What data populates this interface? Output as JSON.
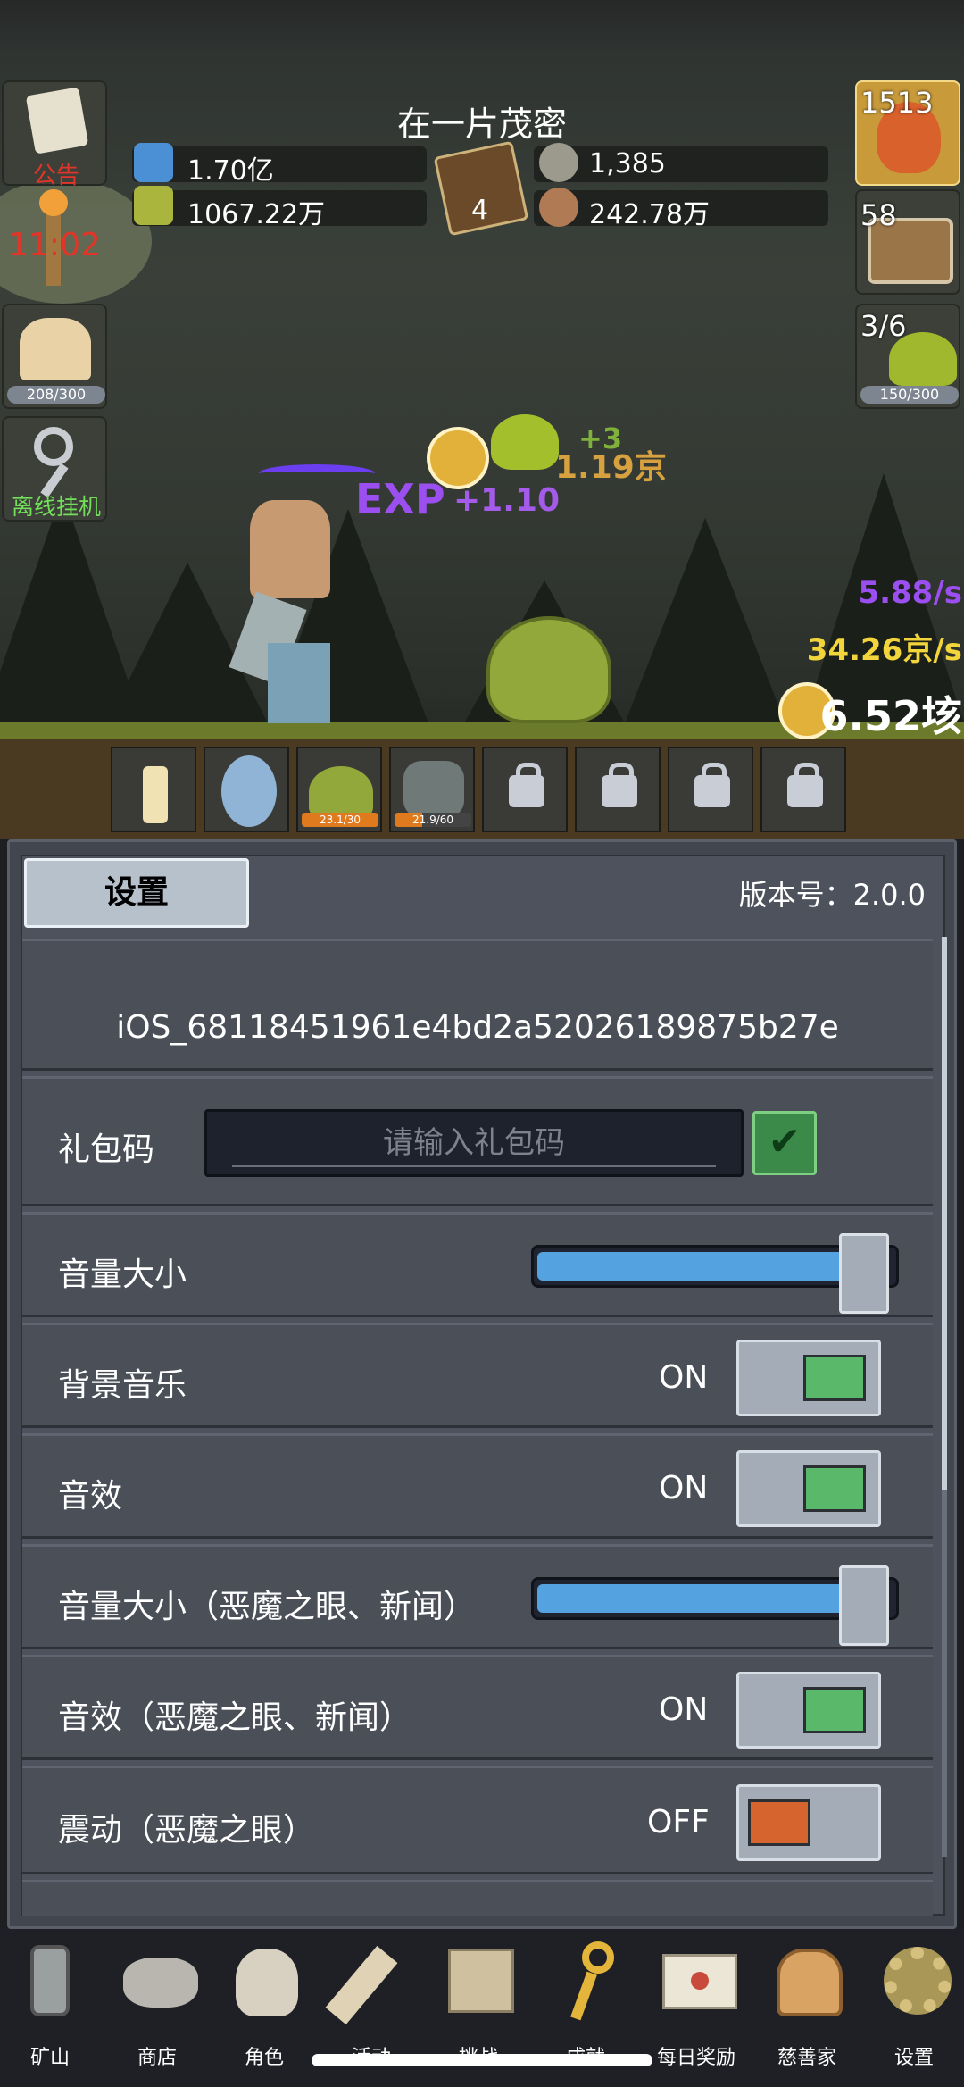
{
  "scene": {
    "title": "在一片茂密",
    "resources": {
      "blue_potion": "1.70亿",
      "green_potion": "1067.22万",
      "book_count": "4",
      "silver_coin": "1,385",
      "meat": "242.78万"
    },
    "left_buttons": {
      "notice_label": "公告",
      "torch_time": "11:02",
      "food_bar": "208/300",
      "offline_label": "离线挂机"
    },
    "right_buttons": {
      "potion_count": "1513",
      "chest_count": "58",
      "slime_progress": "3/6",
      "slime_bar": "150/300"
    },
    "floating": {
      "exp_text": "EXP",
      "exp_value": "+1.10",
      "gold_value": "1.19京",
      "green_plus": "+3"
    },
    "rates": {
      "exp_rate": "5.88/s",
      "gold_rate": "34.26京/s",
      "gold_total": "6.52垓"
    },
    "skills": {
      "slime_bar": "23.1/30",
      "zombie_bar": "21.9/60"
    }
  },
  "settings": {
    "tab_label": "设置",
    "version": "版本号：2.0.0",
    "device_id": "iOS_68118451961e4bd2a52026189875b27e",
    "gift_code_label": "礼包码",
    "gift_code_placeholder": "请输入礼包码",
    "volume_label": "音量大小",
    "bgm_label": "背景音乐",
    "bgm_state": "ON",
    "sfx_label": "音效",
    "sfx_state": "ON",
    "volume2_label": "音量大小（恶魔之眼、新闻）",
    "sfx2_label": "音效（恶魔之眼、新闻）",
    "sfx2_state": "ON",
    "vibration_label": "震动（恶魔之眼）",
    "vibration_state": "OFF",
    "volume_level": 1.0,
    "volume2_level": 1.0
  },
  "colors": {
    "toggle_on": "#59b86a",
    "toggle_off": "#d5642f"
  },
  "nav": [
    {
      "label": "矿山",
      "icon": "lantern-icon"
    },
    {
      "label": "商店",
      "icon": "stone-icon"
    },
    {
      "label": "角色",
      "icon": "skull-icon"
    },
    {
      "label": "活动",
      "icon": "scroll-icon"
    },
    {
      "label": "挑战",
      "icon": "map-icon"
    },
    {
      "label": "成就",
      "icon": "key-icon"
    },
    {
      "label": "每日奖励",
      "icon": "letter-icon"
    },
    {
      "label": "慈善家",
      "icon": "bread-icon"
    },
    {
      "label": "设置",
      "icon": "gear-icon"
    }
  ]
}
